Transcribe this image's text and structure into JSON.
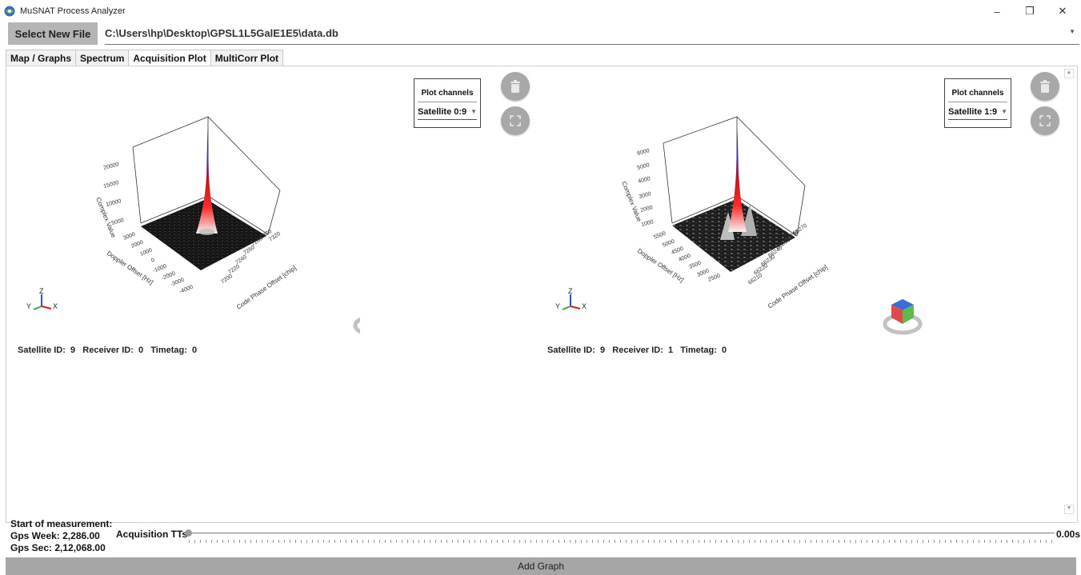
{
  "window": {
    "title": "MuSNAT Process Analyzer",
    "controls": {
      "minimize": "–",
      "restore": "❐",
      "close": "✕"
    }
  },
  "file": {
    "select_button_label": "Select New File",
    "path": "C:\\Users\\hp\\Desktop\\GPSL1L5GalE1E5\\data.db"
  },
  "tabs": [
    {
      "label": "Map / Graphs",
      "active": false
    },
    {
      "label": "Spectrum",
      "active": false
    },
    {
      "label": "Acquisition Plot",
      "active": true
    },
    {
      "label": "MultiCorr Plot",
      "active": false
    }
  ],
  "plots": [
    {
      "plot_channels_title": "Plot channels",
      "selected_channel": "Satellite 0:9",
      "info": "Satellite ID:  9   Receiver ID:  0   Timetag:  0",
      "axes": {
        "z_label": "Complex Value",
        "x_label": "Doppler Offset [Hz]",
        "y_label": "Code Phase Offset [chip]",
        "z_ticks": [
          "5000",
          "10000",
          "15000",
          "20000"
        ],
        "x_ticks": [
          "3000",
          "2000",
          "1000",
          "0",
          "-1000",
          "-2000",
          "-3000",
          "-4000"
        ],
        "y_ticks": [
          "7200",
          "7220",
          "7240",
          "7260",
          "7280",
          "7300",
          "7320"
        ]
      },
      "icons": {
        "delete": "trash-icon",
        "fullscreen": "fullscreen-icon"
      }
    },
    {
      "plot_channels_title": "Plot channels",
      "selected_channel": "Satellite 1:9",
      "info": "Satellite ID:  9   Receiver ID:  1   Timetag:  0",
      "axes": {
        "z_label": "Complex Value",
        "x_label": "Doppler Offset [Hz]",
        "y_label": "Code Phase Offset [chip]",
        "z_ticks": [
          "1000",
          "2000",
          "3000",
          "4000",
          "5000",
          "6000"
        ],
        "x_ticks": [
          "2500",
          "3000",
          "3500",
          "4000",
          "4500",
          "5000",
          "5500"
        ],
        "y_ticks": [
          "66210",
          "66220",
          "66230",
          "66240",
          "66250",
          "66260",
          "66270"
        ]
      },
      "icons": {
        "delete": "trash-icon",
        "fullscreen": "fullscreen-icon"
      }
    }
  ],
  "axis_triad": {
    "z": "Z",
    "y": "Y",
    "x": "X"
  },
  "measurement": {
    "title": "Start of measurement:",
    "gps_week": "Gps Week: 2,286.00",
    "gps_sec": "Gps Sec: 2,12,068.00"
  },
  "slider": {
    "label": "Acquisition TTs",
    "value_text": "0.00s",
    "position_fraction": 0
  },
  "add_graph_label": "Add Graph",
  "colors": {
    "accent_gray": "#a6a6a6",
    "peak_blue": "#2a2ab0",
    "peak_red": "#d01818"
  }
}
